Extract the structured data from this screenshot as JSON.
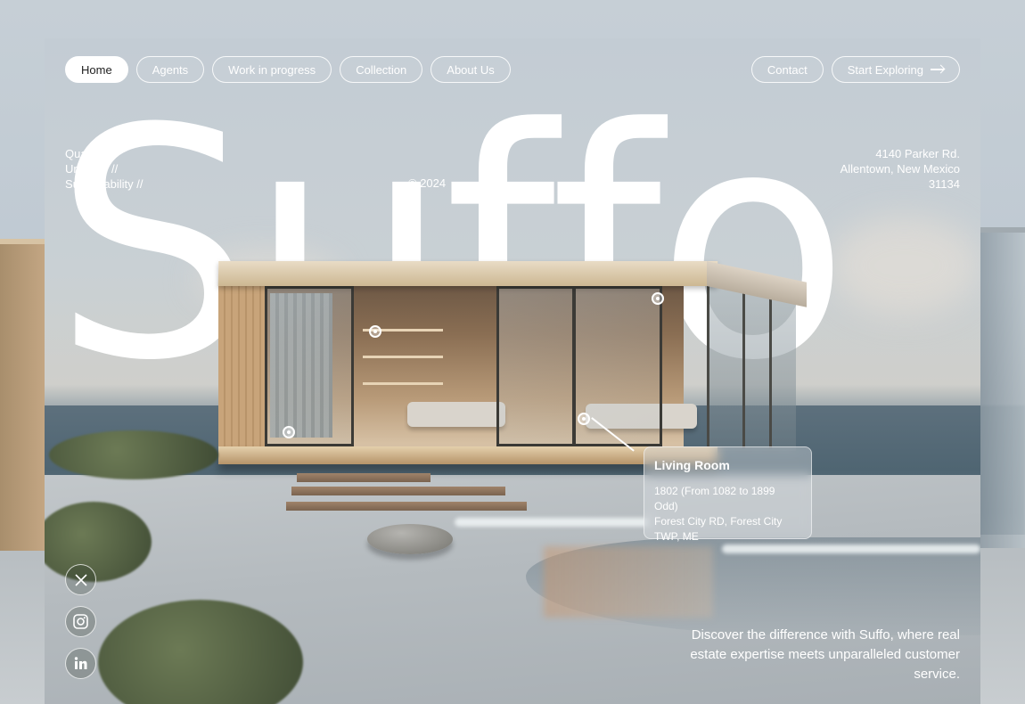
{
  "nav": {
    "left": [
      {
        "label": "Home",
        "active": true
      },
      {
        "label": "Agents",
        "active": false
      },
      {
        "label": "Work in progress",
        "active": false
      },
      {
        "label": "Collection",
        "active": false
      },
      {
        "label": "About Us",
        "active": false
      }
    ],
    "right": [
      {
        "label": "Contact"
      },
      {
        "label": "Start Exploring",
        "icon": "arrow-right-icon"
      }
    ]
  },
  "hero": {
    "title": "Suffo",
    "values": [
      "Quality //",
      "Urbanity //",
      "Sustainability //"
    ],
    "copyright": "© 2024",
    "address": [
      "4140 Parker Rd.",
      "Allentown, New Mexico",
      "31134"
    ]
  },
  "info_card": {
    "title": "Living Room",
    "lines": [
      "1802 (From 1082 to 1899 Odd)",
      "Forest City RD, Forest City",
      "TWP, ME"
    ]
  },
  "social": [
    {
      "name": "x-icon"
    },
    {
      "name": "instagram-icon"
    },
    {
      "name": "linkedin-icon"
    }
  ],
  "tagline": "Discover the difference with Suffo, where real estate expertise meets unparalleled customer service.",
  "colors": {
    "text": "#ffffff",
    "active_pill_bg": "#ffffff",
    "active_pill_text": "#1e1e1e"
  }
}
